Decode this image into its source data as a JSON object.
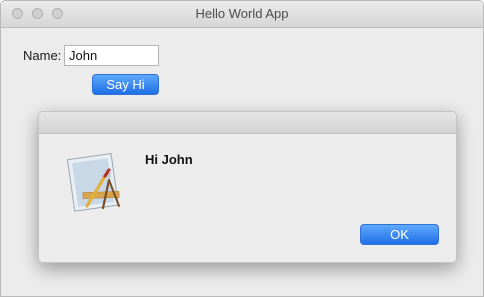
{
  "window": {
    "title": "Hello World App"
  },
  "form": {
    "name_label": "Name:",
    "name_value": "John",
    "say_hi_label": "Say Hi"
  },
  "alert": {
    "message": "Hi John",
    "ok_label": "OK",
    "icon": "app-icon-pencil-ruler"
  },
  "colors": {
    "accent_button": "#1f6fe8",
    "window_bg": "#ececec"
  }
}
